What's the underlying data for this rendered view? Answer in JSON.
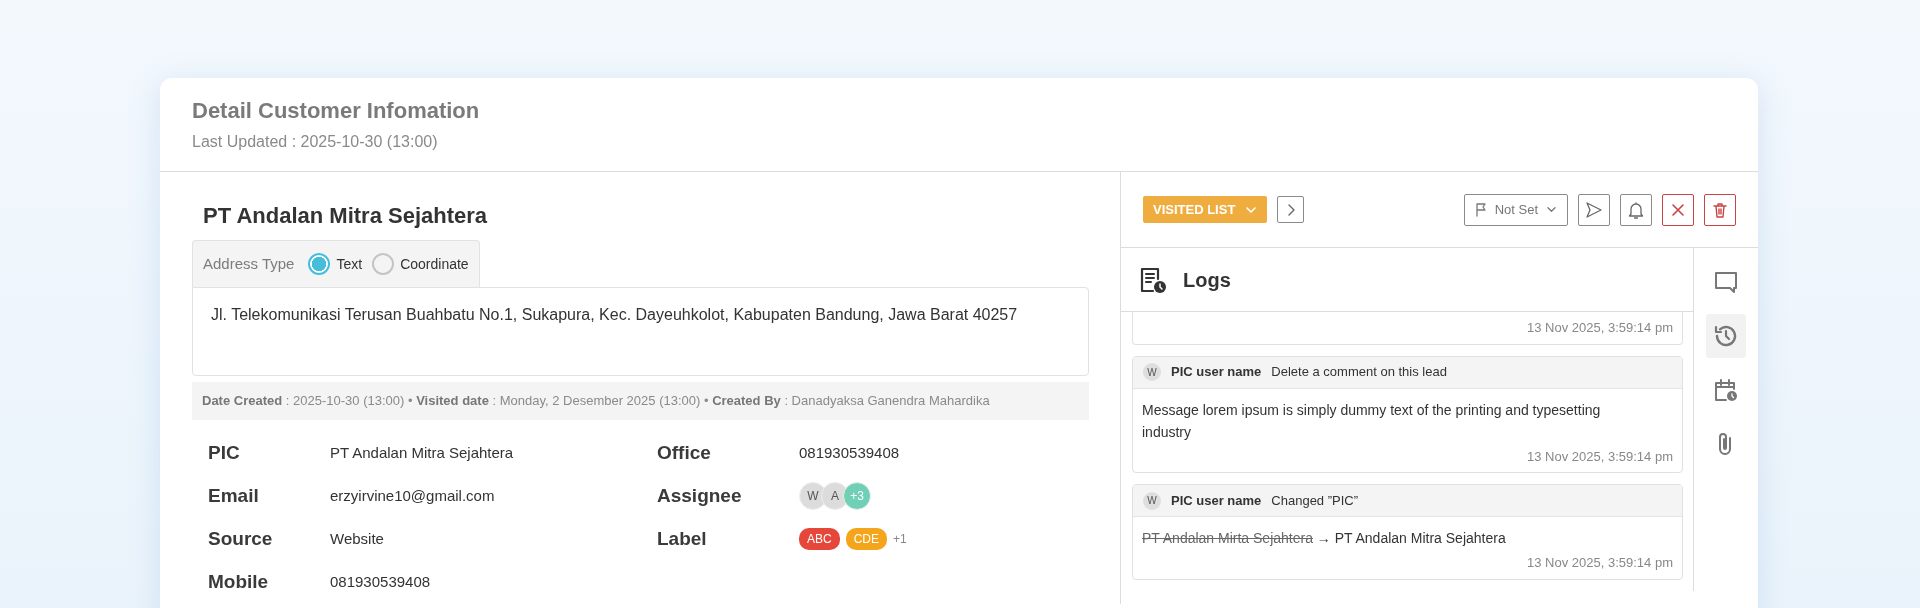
{
  "header": {
    "title": "Detail Customer Infomation",
    "subtitle": "Last Updated : 2025-10-30 (13:00)"
  },
  "customer": {
    "name": "PT Andalan Mitra Sejahtera",
    "address_type": {
      "label": "Address Type",
      "options": [
        {
          "label": "Text",
          "selected": true
        },
        {
          "label": "Coordinate",
          "selected": false
        }
      ]
    },
    "address": "Jl. Telekomunikasi Terusan Buahbatu No.1, Sukapura, Kec. Dayeuhkolot, Kabupaten Bandung, Jawa Barat 40257",
    "meta": "**Date Created** : 2025-10-30 (13:00) • **Visited date** : Monday, 2 Desember 2025 (13:00) • **Created By** : Danadyaksa Ganendra Mahardika",
    "fields_left": [
      {
        "label": "PIC",
        "value": "PT Andalan Mitra Sejahtera"
      },
      {
        "label": "Email",
        "value": "erzyirvine10@gmail.com"
      },
      {
        "label": "Source",
        "value": "Website"
      },
      {
        "label": "Mobile",
        "value": "081930539408"
      }
    ],
    "fields_right": [
      {
        "label": "Office",
        "kind": "text",
        "value": "081930539408"
      },
      {
        "label": "Assignee",
        "kind": "avatars",
        "avatars": [
          "W",
          "A"
        ],
        "more": "+3"
      },
      {
        "label": "Label",
        "kind": "tags",
        "tags": [
          {
            "text": "ABC",
            "color": "#e5483b"
          },
          {
            "text": "CDE",
            "color": "#f4a51c"
          }
        ],
        "more": "+1"
      }
    ]
  },
  "toolbar": {
    "status_button": "VISITED LIST",
    "priority": "Not Set"
  },
  "logs": {
    "title": "Logs",
    "entries": [
      {
        "kind": "partial",
        "time": "13 Nov 2025, 3:59:14 pm"
      },
      {
        "kind": "message",
        "avatar": "W",
        "user": "PIC user name",
        "action": "Delete a comment on this lead",
        "body": "Message lorem ipsum is simply dummy text of the printing and typesetting industry",
        "time": "13 Nov 2025, 3:59:14 pm"
      },
      {
        "kind": "change",
        "avatar": "W",
        "user": "PIC user name",
        "action": "Changed ”PIC”",
        "old": "PT Andalan Mirta Sejahtera",
        "arrow": "→",
        "new": "PT Andalan Mitra Sejahtera",
        "time": "13 Nov 2025, 3:59:14 pm"
      }
    ]
  },
  "side_tabs": [
    {
      "kind": "comment",
      "selected": false
    },
    {
      "kind": "history",
      "selected": true
    },
    {
      "kind": "calendar",
      "selected": false
    },
    {
      "kind": "attachment",
      "selected": false
    }
  ]
}
